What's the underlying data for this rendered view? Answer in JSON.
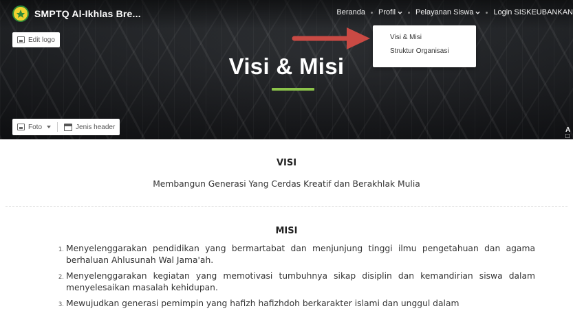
{
  "header": {
    "brand_name": "SMPTQ Al-Ikhlas Bre...",
    "nav": [
      {
        "label": "Beranda",
        "has_dropdown": false
      },
      {
        "label": "Profil",
        "has_dropdown": true
      },
      {
        "label": "Pelayanan Siswa",
        "has_dropdown": true
      },
      {
        "label": "Login SISKEUBANKAN",
        "has_dropdown": false
      }
    ]
  },
  "profil_dropdown": {
    "items": [
      {
        "label": "Visi & Misi"
      },
      {
        "label": "Struktur Organisasi"
      }
    ]
  },
  "hero": {
    "edit_logo_label": "Edit logo",
    "title": "Visi & Misi",
    "foto_label": "Foto",
    "jenis_header_label": "Jenis header",
    "corner_glyph": "A"
  },
  "content": {
    "visi_heading": "VISI",
    "visi_text": "Membangun Generasi Yang Cerdas Kreatif dan Berakhlak Mulia",
    "misi_heading": "MISI",
    "misi_items": [
      {
        "num": "1.",
        "text": "Menyelenggarakan pendidikan yang bermartabat dan menjunjung tinggi ilmu pengetahuan dan agama berhaluan Ahlusunah Wal Jama'ah."
      },
      {
        "num": "2.",
        "text": "Menyelenggarakan kegiatan yang memotivasi tumbuhnya sikap disiplin dan kemandirian siswa dalam menyelesaikan masalah kehidupan."
      },
      {
        "num": "3.",
        "text": "Mewujudkan generasi pemimpin yang hafizh hafizhdoh berkarakter islami dan unggul dalam"
      }
    ]
  },
  "colors": {
    "title_underline": "#8bc34a",
    "arrow": "#c94a44",
    "logo_ring": "#2f8a3a",
    "logo_fill": "#f0d230"
  }
}
